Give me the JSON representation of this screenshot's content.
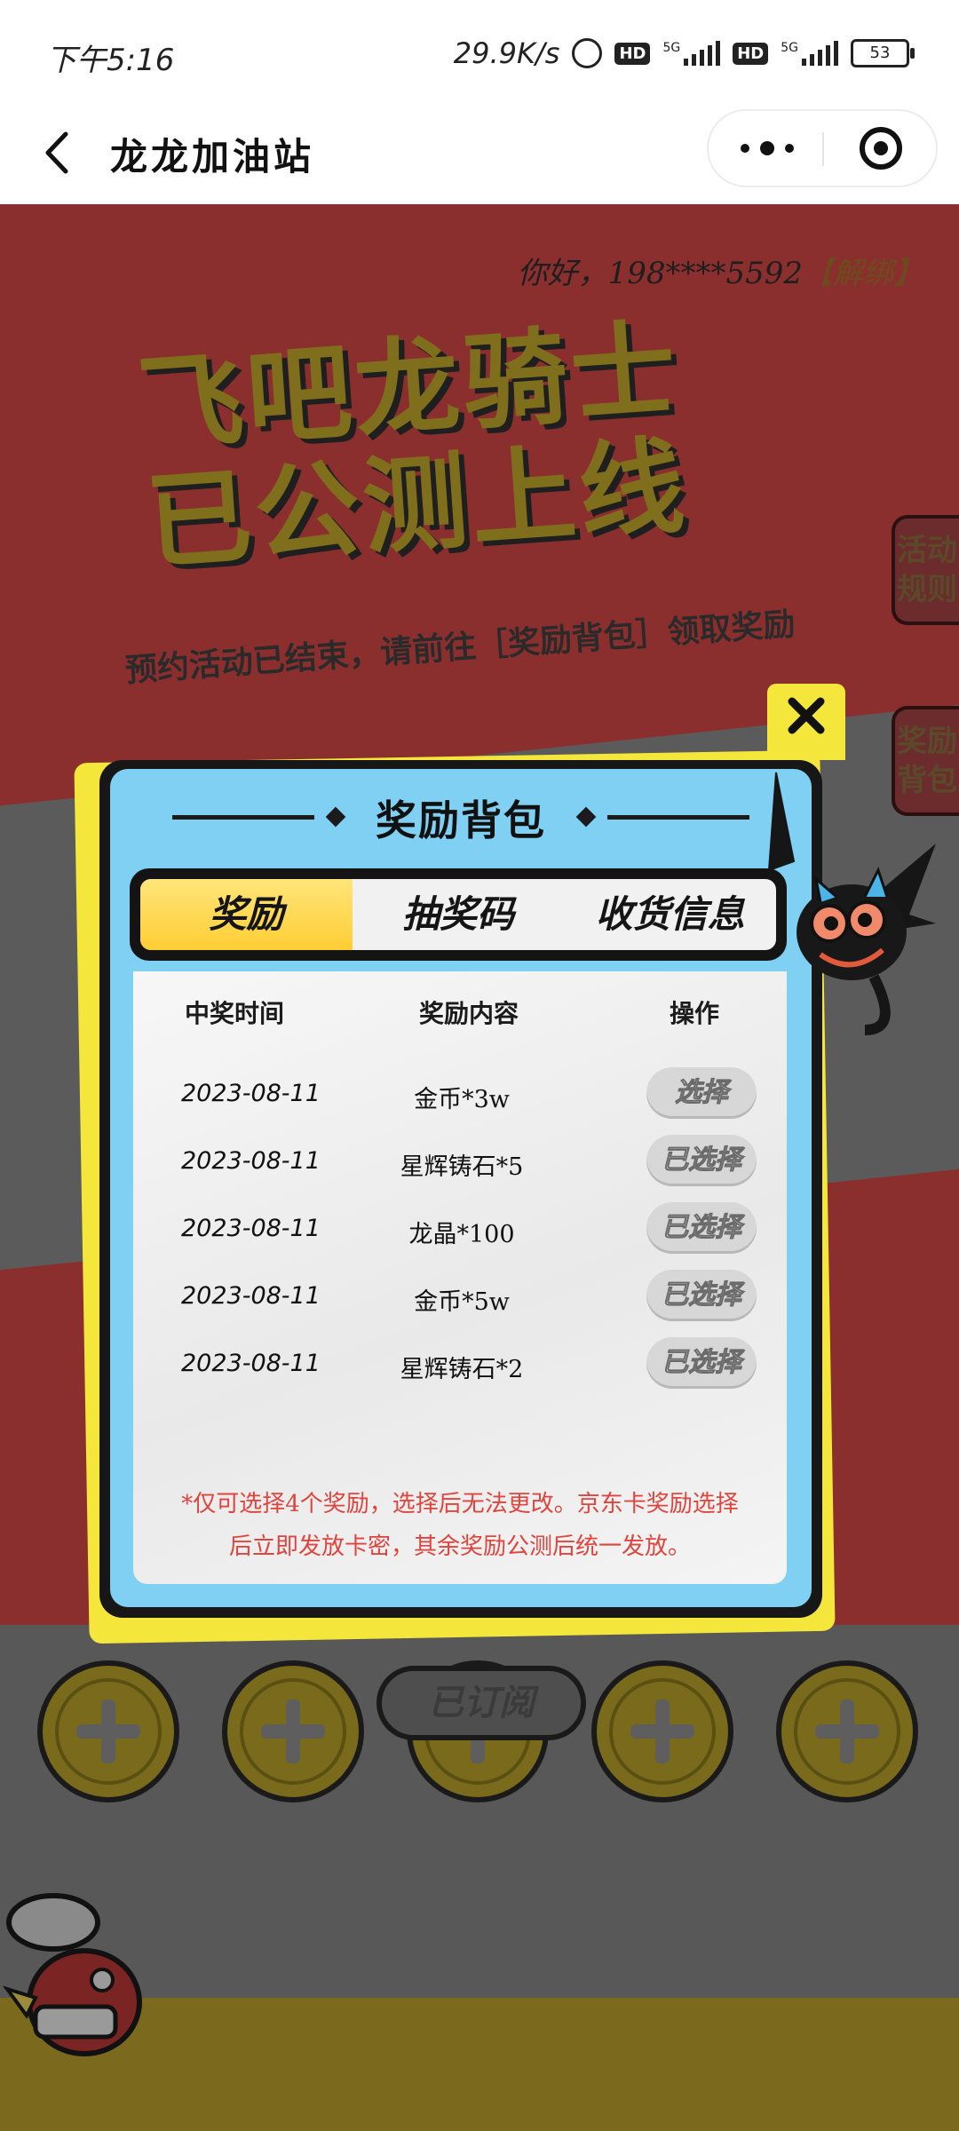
{
  "status_bar": {
    "time": "下午5:16",
    "network_speed": "29.9K/s",
    "battery": "53",
    "badges": [
      "HD",
      "HD"
    ],
    "signal_labels": [
      "5G",
      "5G"
    ]
  },
  "title_bar": {
    "title": "龙龙加油站",
    "icons": [
      "back-icon",
      "more-icon",
      "target-icon"
    ]
  },
  "background_page": {
    "greeting": "你好，198****5592",
    "unbind": "【解绑】",
    "headline_line1": "飞吧龙骑士",
    "headline_line2": "已公测上线",
    "subhead": "预约活动已结束，请前往［奖励背包］领取奖励",
    "side_tabs": [
      "活动规则",
      "奖励背包"
    ],
    "subscribed_label": "已订阅"
  },
  "modal": {
    "title": "奖励背包",
    "tabs": [
      {
        "label": "奖励",
        "active": true
      },
      {
        "label": "抽奖码",
        "active": false
      },
      {
        "label": "收货信息",
        "active": false
      }
    ],
    "columns": [
      "中奖时间",
      "奖励内容",
      "操作"
    ],
    "rows": [
      {
        "date": "2023-08-11",
        "reward": "金币*3w",
        "action": "选择"
      },
      {
        "date": "2023-08-11",
        "reward": "星辉铸石*5",
        "action": "已选择"
      },
      {
        "date": "2023-08-11",
        "reward": "龙晶*100",
        "action": "已选择"
      },
      {
        "date": "2023-08-11",
        "reward": "金币*5w",
        "action": "已选择"
      },
      {
        "date": "2023-08-11",
        "reward": "星辉铸石*2",
        "action": "已选择"
      }
    ],
    "note_line1": "*仅可选择4个奖励，选择后无法更改。京东卡奖励选择",
    "note_line2": "后立即发放卡密，其余奖励公测后统一发放。"
  },
  "colors": {
    "modal_bg": "#7fd0f3",
    "modal_border_yellow": "#f4e63a",
    "active_tab": "#ffce33",
    "note_red": "#e0443d",
    "dim_bg": "#8b2f2e"
  }
}
